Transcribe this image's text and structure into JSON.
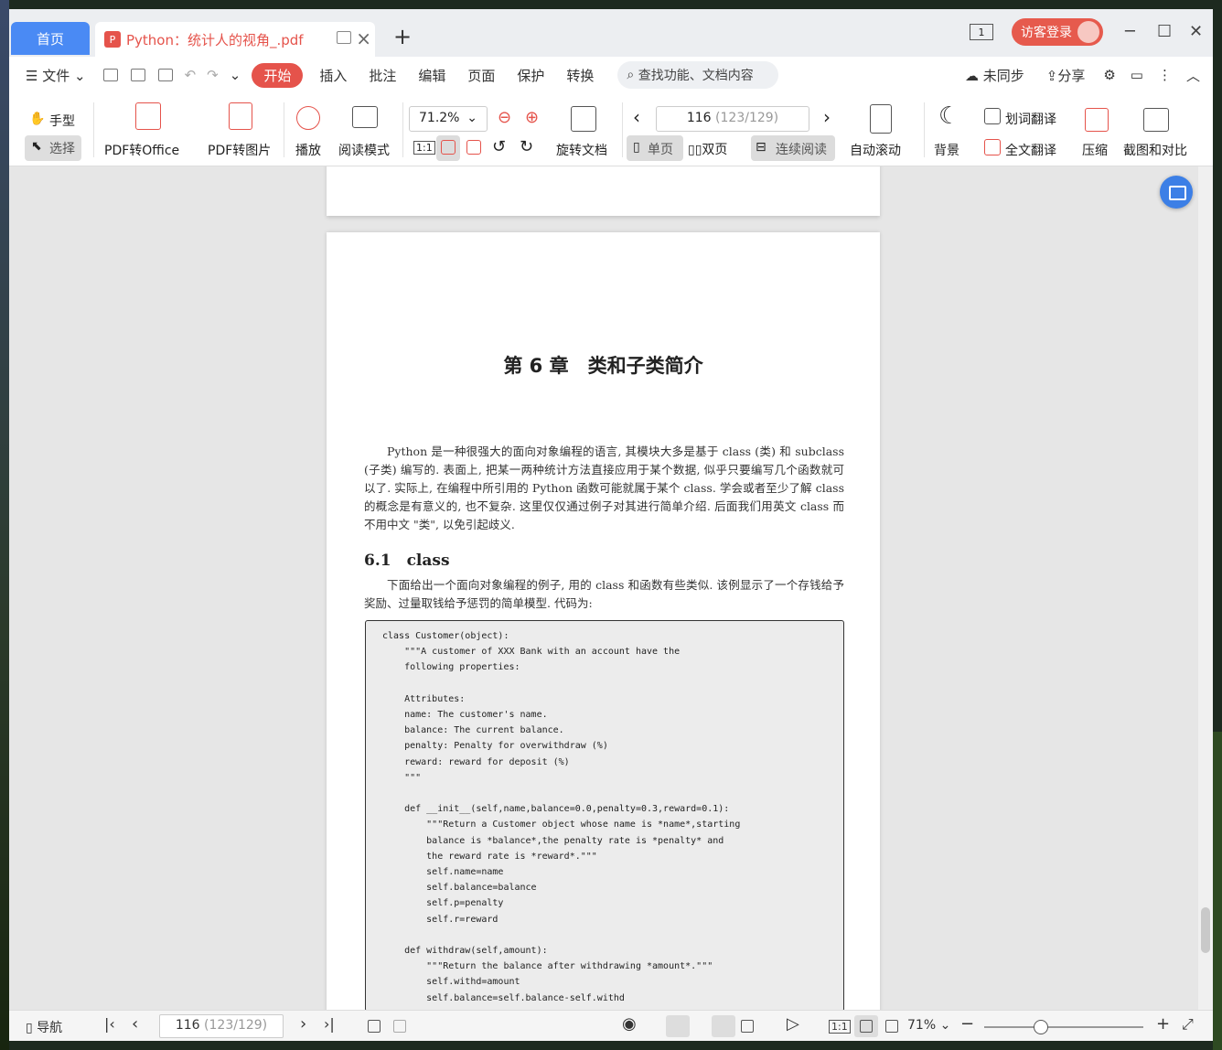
{
  "tabs": {
    "home": "首页",
    "doc_title": "Python：统计人的视角_.pdf",
    "add": "+"
  },
  "titlebar": {
    "window_count": "1",
    "login": "访客登录"
  },
  "menubar": {
    "file": "文件",
    "items": [
      "开始",
      "插入",
      "批注",
      "编辑",
      "页面",
      "保护",
      "转换"
    ],
    "search_placeholder": "查找功能、文档内容",
    "sync": "未同步",
    "share": "分享"
  },
  "ribbon": {
    "hand": "手型",
    "select": "选择",
    "pdf_to_office": "PDF转Office",
    "pdf_to_image": "PDF转图片",
    "play": "播放",
    "read_mode": "阅读模式",
    "zoom": "71.2%",
    "actual_size": "1:1",
    "rotate_doc": "旋转文档",
    "page_current": "116",
    "page_total": "(123/129)",
    "single_page": "单页",
    "double_page": "双页",
    "continuous": "连续阅读",
    "auto_scroll": "自动滚动",
    "background": "背景",
    "word_translate": "划词翻译",
    "full_translate": "全文翻译",
    "compress": "压缩",
    "screenshot_compare": "截图和对比"
  },
  "document": {
    "chapter_title": "第 6 章　类和子类简介",
    "intro": "Python 是一种很强大的面向对象编程的语言, 其模块大多是基于 class (类) 和 subclass (子类) 编写的. 表面上, 把某一两种统计方法直接应用于某个数据, 似乎只要编写几个函数就可以了. 实际上, 在编程中所引用的 Python 函数可能就属于某个 class. 学会或者至少了解 class 的概念是有意义的, 也不复杂. 这里仅仅通过例子对其进行简单介绍. 后面我们用英文 class 而不用中文 \"类\", 以免引起歧义.",
    "section_title": "6.1　class",
    "section_intro": "下面给出一个面向对象编程的例子, 用的 class 和函数有些类似. 该例显示了一个存钱给予奖励、过量取钱给予惩罚的简单模型. 代码为:",
    "code": "class Customer(object):\n    \"\"\"A customer of XXX Bank with an account have the\n    following properties:\n\n    Attributes:\n    name: The customer's name.\n    balance: The current balance.\n    penalty: Penalty for overwithdraw (%)\n    reward: reward for deposit (%)\n    \"\"\"\n\n    def __init__(self,name,balance=0.0,penalty=0.3,reward=0.1):\n        \"\"\"Return a Customer object whose name is *name*,starting\n        balance is *balance*,the penalty rate is *penalty* and\n        the reward rate is *reward*.\"\"\"\n        self.name=name\n        self.balance=balance\n        self.p=penalty\n        self.r=reward\n\n    def withdraw(self,amount):\n        \"\"\"Return the balance after withdrawing *amount*.\"\"\"\n        self.withd=amount\n        self.balance=self.balance-self.withd"
  },
  "statusbar": {
    "nav": "导航",
    "page_current": "116",
    "page_total": "(123/129)",
    "actual_size": "1:1",
    "zoom": "71%"
  },
  "colors": {
    "accent": "#4a8af4",
    "brand_red": "#e5534b"
  }
}
